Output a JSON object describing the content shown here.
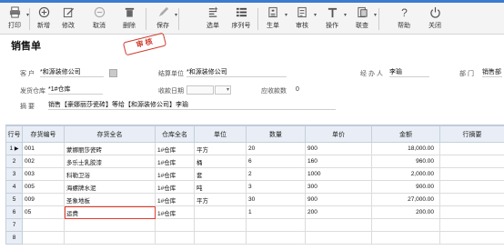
{
  "toolbar": {
    "items": [
      {
        "label": "打印",
        "icon": "printer-icon"
      },
      {
        "label": "新增",
        "icon": "add-icon"
      },
      {
        "label": "修改",
        "icon": "edit-icon"
      },
      {
        "label": "取消",
        "icon": "cancel-icon"
      },
      {
        "label": "删除",
        "icon": "delete-icon"
      },
      {
        "label": "保存",
        "icon": "save-icon"
      },
      {
        "label": "选单",
        "icon": "select-order-icon"
      },
      {
        "label": "序列号",
        "icon": "serial-number-icon"
      },
      {
        "label": "生单",
        "icon": "generate-order-icon"
      },
      {
        "label": "审核",
        "icon": "audit-icon"
      },
      {
        "label": "操作",
        "icon": "operate-icon"
      },
      {
        "label": "联查",
        "icon": "link-query-icon"
      },
      {
        "label": "帮助",
        "icon": "help-icon"
      },
      {
        "label": "关闭",
        "icon": "power-icon"
      }
    ]
  },
  "form": {
    "title": "销售单",
    "stamp": "审 核",
    "customer_label": "客    户",
    "customer_value": "*和源装修公司",
    "settle_label": "结算单位",
    "settle_value": "*和源装修公司",
    "handler_label": "经 办 人",
    "handler_value": "李瑜",
    "dept_label": "部     门",
    "dept_value": "销售部",
    "warehouse_label": "发货仓库",
    "warehouse_value": "*1#仓库",
    "paydate_label": "收款日期",
    "receivable_label": "应收款数",
    "receivable_value": "0",
    "summary_label": "摘      要",
    "summary_value": "销售【豪娜丽莎瓷砖】等给【和源装修公司】李瑜"
  },
  "table": {
    "headers": [
      "行号",
      "存货编号",
      "存货全名",
      "仓库全名",
      "单位",
      "数量",
      "单价",
      "金额",
      "行摘要"
    ],
    "rows": [
      {
        "n": "1",
        "code": "001",
        "name": "蒙娜丽莎瓷砖",
        "wh": "1#仓库",
        "unit": "平方",
        "qty": "20",
        "price": "900",
        "amount": "18,000.00",
        "memo": ""
      },
      {
        "n": "2",
        "code": "002",
        "name": "多乐士乳胶漆",
        "wh": "1#仓库",
        "unit": "桶",
        "qty": "6",
        "price": "160",
        "amount": "960.00",
        "memo": ""
      },
      {
        "n": "3",
        "code": "003",
        "name": "科勒卫浴",
        "wh": "1#仓库",
        "unit": "套",
        "qty": "2",
        "price": "1000",
        "amount": "2,000.00",
        "memo": ""
      },
      {
        "n": "4",
        "code": "005",
        "name": "海螺牌水泥",
        "wh": "1#仓库",
        "unit": "吨",
        "qty": "3",
        "price": "300",
        "amount": "900.00",
        "memo": ""
      },
      {
        "n": "5",
        "code": "009",
        "name": "圣象地板",
        "wh": "1#仓库",
        "unit": "平方",
        "qty": "30",
        "price": "900",
        "amount": "27,000.00",
        "memo": ""
      },
      {
        "n": "6",
        "code": "05",
        "name": "运费",
        "wh": "1#仓库",
        "unit": "",
        "qty": "1",
        "price": "200",
        "amount": "200.00",
        "memo": ""
      },
      {
        "n": "7",
        "code": "",
        "name": "",
        "wh": "",
        "unit": "",
        "qty": "",
        "price": "",
        "amount": "",
        "memo": ""
      },
      {
        "n": "8",
        "code": "",
        "name": "",
        "wh": "",
        "unit": "",
        "qty": "",
        "price": "",
        "amount": "",
        "memo": ""
      }
    ]
  }
}
